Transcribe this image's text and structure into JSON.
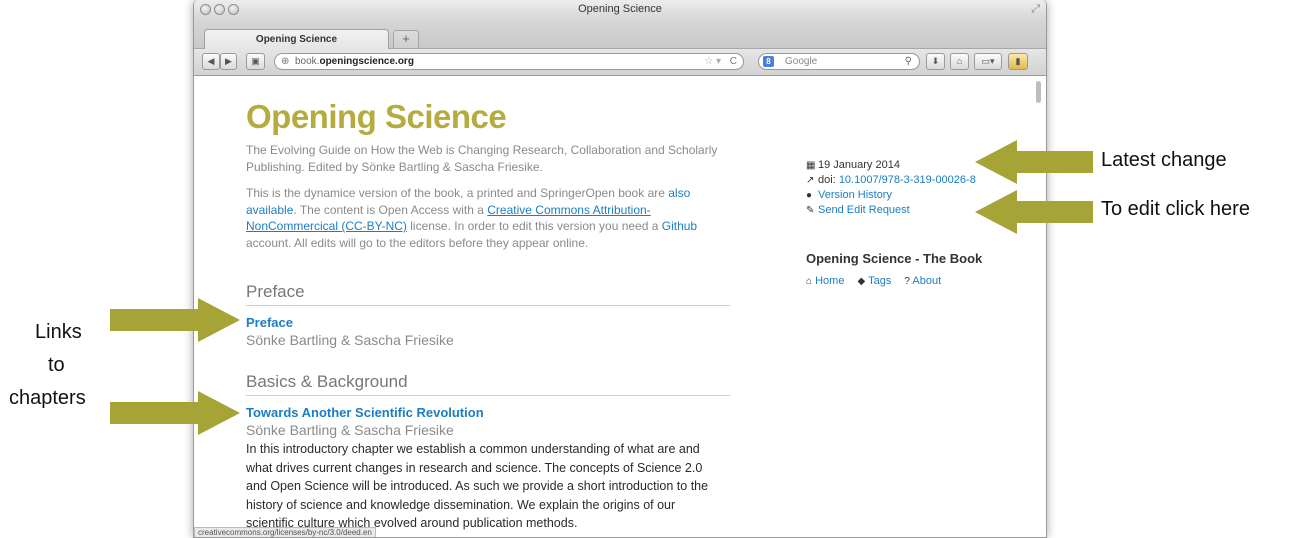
{
  "window": {
    "title": "Opening Science",
    "tab_label": "Opening Science",
    "new_tab_symbol": "+",
    "url_host_prefix": "book.",
    "url_host_main": "openingscience.org",
    "search_placeholder": "Google",
    "status_url": "creativecommons.org/licenses/by-nc/3.0/deed.en"
  },
  "page": {
    "site_title": "Opening Science",
    "intro": "The Evolving Guide on How the Web is Changing Research, Collaboration and Scholarly Publishing. Edited by Sönke Bartling & Sascha Friesike.",
    "desc_part1": "This is the dynamice version of the book, a printed and SpringerOpen book are ",
    "desc_link_also": "also available",
    "desc_part2": ". The content is Open Access with a ",
    "desc_link_license": "Creative Commons Attribution-NonCommercical (CC-BY-NC)",
    "desc_part3": " license. In order to edit this version you need a ",
    "desc_link_github": "Github",
    "desc_part4": " account. All edits will go to the editors before they appear online.",
    "sections": [
      {
        "heading": "Preface",
        "chapter_title": "Preface",
        "authors": "Sönke Bartling & Sascha Friesike"
      },
      {
        "heading": "Basics & Background",
        "chapter_title": "Towards Another Scientific Revolution",
        "authors": "Sönke Bartling & Sascha Friesike",
        "abstract": "In this introductory chapter we establish a common understanding of what are and what drives current changes in research and science. The concepts of Science 2.0 and Open Science will be introduced. As such we provide a short introduction to the history of science and knowledge dissemination. We explain the origins of our scientific culture which evolved around publication methods."
      }
    ],
    "meta": {
      "date": "19 January 2014",
      "doi_label": "doi:",
      "doi_value": "10.1007/978-3-319-00026-8",
      "version_history": "Version History",
      "send_edit": "Send Edit Request"
    },
    "book_title": "Opening Science - The Book",
    "nav": [
      "Home",
      "Tags",
      "About"
    ]
  },
  "annotations": {
    "latest_change": "Latest change",
    "edit_here": "To edit click here",
    "links_line1": "Links",
    "links_line2": "to",
    "links_line3": "chapters"
  },
  "colors": {
    "title_olive": "#b5ac3f",
    "link_blue": "#1b7ec2",
    "arrow_fill": "#a7a437"
  }
}
